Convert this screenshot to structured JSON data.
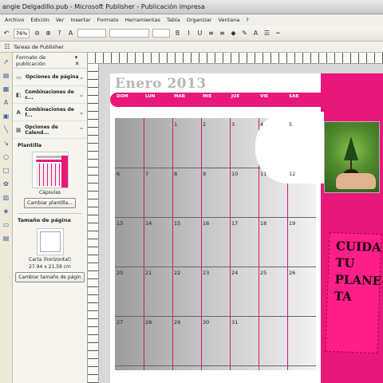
{
  "window": {
    "title": "angie Delgadillo.pub - Microsoft Publisher - Publicación impresa"
  },
  "menu": [
    "Archivo",
    "Edición",
    "Ver",
    "Insertar",
    "Formato",
    "Herramientas",
    "Tabla",
    "Organizar",
    "Ventana",
    "?"
  ],
  "toolbar": {
    "zoom": "76%"
  },
  "toolbar2": {
    "label": "Tareas de Publisher"
  },
  "taskpane": {
    "title": "Formato de publicación",
    "rows": [
      "Opciones de página",
      "Combinaciones de c...",
      "Combinaciones de f...",
      "Opciones de Calend..."
    ],
    "template_heading": "Plantilla",
    "template_name": "Cápsulas",
    "change_template": "Cambiar plantilla...",
    "page_size_heading": "Tamaño de página",
    "page_size_name": "Carta (horizontal)",
    "page_size_dims": "27.94 x 21.59 cm",
    "change_page_size": "Cambiar tamaño de págin"
  },
  "calendar": {
    "month": "Enero 2013",
    "days": [
      "DOM",
      "LUN",
      "MAR",
      "MIE",
      "JUE",
      "VIE",
      "SAB"
    ],
    "weeks": [
      [
        "",
        "",
        "1",
        "2",
        "3",
        "4",
        "5"
      ],
      [
        "6",
        "7",
        "8",
        "9",
        "10",
        "11",
        "12"
      ],
      [
        "13",
        "14",
        "15",
        "16",
        "17",
        "18",
        "19"
      ],
      [
        "20",
        "21",
        "22",
        "23",
        "24",
        "25",
        "26"
      ],
      [
        "27",
        "28",
        "29",
        "30",
        "31",
        "",
        ""
      ]
    ]
  },
  "slogan": [
    "CUIDA",
    "TU",
    "PLANE-",
    "TA"
  ],
  "colors": {
    "accent": "#e8187a"
  }
}
